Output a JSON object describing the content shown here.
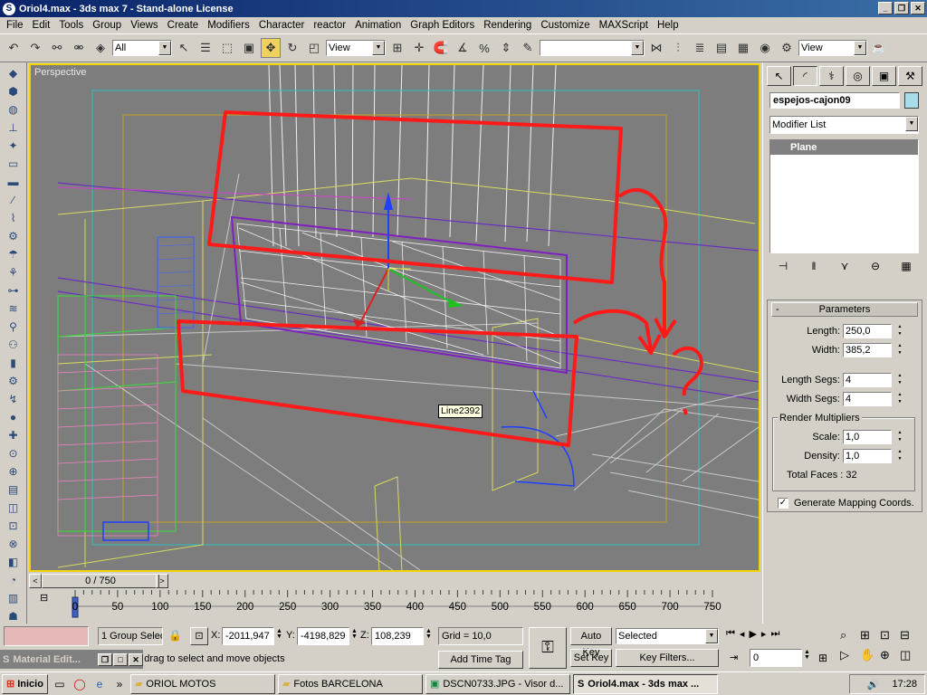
{
  "window": {
    "title": "Oriol4.max - 3ds max 7 - Stand-alone License"
  },
  "menu": [
    "File",
    "Edit",
    "Tools",
    "Group",
    "Views",
    "Create",
    "Modifiers",
    "Character",
    "reactor",
    "Animation",
    "Graph Editors",
    "Rendering",
    "Customize",
    "MAXScript",
    "Help"
  ],
  "toolbar": {
    "selection_filter": "All",
    "ref_coord": "View",
    "named_selection": "",
    "render_view": "View"
  },
  "viewport": {
    "label": "Perspective",
    "tooltip": "Line2392"
  },
  "command_panel": {
    "object_name": "espejos-cajon09",
    "object_color": "#a8dce8",
    "modifier_list": "Modifier List",
    "stack_items": [
      "Plane"
    ],
    "parameters": {
      "title": "Parameters",
      "length_label": "Length:",
      "length": "250,0",
      "width_label": "Width:",
      "width": "385,2",
      "length_segs_label": "Length Segs:",
      "length_segs": "4",
      "width_segs_label": "Width Segs:",
      "width_segs": "4",
      "render_multipliers": "Render Multipliers",
      "scale_label": "Scale:",
      "scale": "1,0",
      "density_label": "Density:",
      "density": "1,0",
      "total_faces": "Total Faces : 32",
      "gen_mapping": "Generate Mapping Coords.",
      "gen_mapping_checked": true
    }
  },
  "timeline": {
    "slider": "0 / 750",
    "ticks": [
      "0",
      "50",
      "100",
      "150",
      "200",
      "250",
      "300",
      "350",
      "400",
      "450",
      "500",
      "550",
      "600",
      "650",
      "700",
      "750"
    ]
  },
  "status": {
    "selection": "1 Group Selec",
    "x_label": "X:",
    "x": "-2011,947",
    "y_label": "Y:",
    "y": "-4198,829",
    "z_label": "Z:",
    "z": "108,239",
    "grid": "Grid = 10,0",
    "prompt": "Click and drag to select and move objects",
    "add_time_tag": "Add Time Tag",
    "auto_key": "Auto Key",
    "set_key": "Set Key",
    "key_mode": "Selected",
    "key_filters": "Key Filters...",
    "frame": "0",
    "material_editor": "Material Edit..."
  },
  "taskbar": {
    "start": "Inicio",
    "items": [
      "ORIOL MOTOS",
      "Fotos BARCELONA",
      "DSCN0733.JPG - Visor d...",
      "Oriol4.max - 3ds max ..."
    ],
    "active_index": 3,
    "clock": "17:28"
  }
}
